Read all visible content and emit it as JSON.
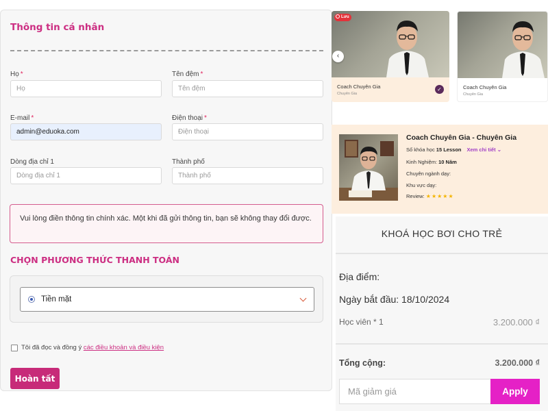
{
  "form": {
    "title": "Thông tin cá nhân",
    "fields": {
      "last_name": {
        "label": "Họ",
        "placeholder": "Họ"
      },
      "middle_name": {
        "label": "Tên đệm",
        "placeholder": "Tên đệm"
      },
      "email": {
        "label": "E-mail",
        "value": "admin@eduoka.com"
      },
      "phone": {
        "label": "Điện thoại",
        "placeholder": "Điện thoại"
      },
      "address": {
        "label": "Dòng địa chỉ 1",
        "placeholder": "Dòng địa chỉ 1"
      },
      "city": {
        "label": "Thành phố",
        "placeholder": "Thành phố"
      }
    },
    "required_mark": "*",
    "notice": "Vui lòng điền thông tin chính xác. Một khi đã gửi thông tin, bạn sẽ không thay đổi được.",
    "payment_title": "CHỌN PHƯƠNG THỨC THANH TOÁN",
    "payment_selected": "Tiền mặt",
    "terms_prefix": "Tôi đã đọc và đồng ý",
    "terms_link": "các điều khoản và điều kiện",
    "submit_label": "Hoàn tất"
  },
  "cards": [
    {
      "name": "Coach Chuyên Gia",
      "subtitle": "Chuyên Gia",
      "badge": "Lưu",
      "selected": true
    },
    {
      "name": "Coach Chuyên Gia",
      "subtitle": "Chuyên Gia"
    }
  ],
  "coach_detail": {
    "title": "Coach Chuyên Gia - Chuyên Gia",
    "courses_label": "Số khóa học",
    "courses_value": "15 Lesson",
    "see_more": "Xem chi tiết",
    "experience_label": "Kinh Nghiệm:",
    "experience_value": "10 Năm",
    "specialty_label": "Chuyên ngành dạy:",
    "area_label": "Khu vực dạy:",
    "review_label": "Review:",
    "rating": 5
  },
  "summary": {
    "course_title": "KHOÁ HỌC BƠI CHO TRẺ",
    "location_label": "Địa điểm:",
    "start_date_label": "Ngày bắt đầu: 18/10/2024",
    "student_label": "Học viên * 1",
    "student_price": "3.200.000 ₫",
    "total_label": "Tổng cộng:",
    "total_value": "3.200.000 ₫",
    "coupon_placeholder": "Mã giảm giá",
    "apply_label": "Apply"
  },
  "colors": {
    "accent": "#c72b79",
    "apply": "#e521c6",
    "card_bg": "#fdeede"
  }
}
